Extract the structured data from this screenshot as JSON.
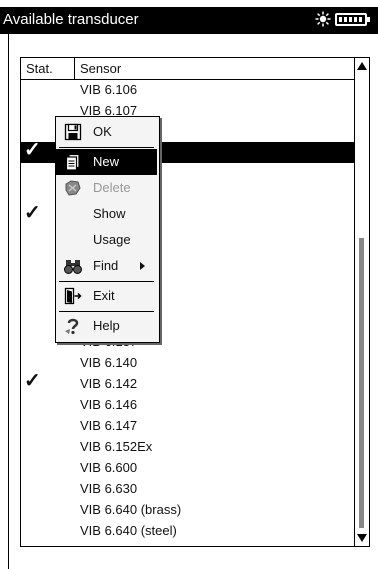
{
  "window": {
    "title": "Available transducer"
  },
  "table": {
    "headers": {
      "stat": "Stat.",
      "sensor": "Sensor"
    },
    "rows": [
      {
        "sensor": "VIB 6.106",
        "stat": ""
      },
      {
        "sensor": "VIB 6.107",
        "stat": ""
      },
      {
        "sensor": "",
        "stat": ""
      },
      {
        "sensor": "",
        "stat": "✓"
      },
      {
        "sensor": "",
        "stat": ""
      },
      {
        "sensor": "",
        "stat": ""
      },
      {
        "sensor": "",
        "stat": "✓"
      },
      {
        "sensor": "",
        "stat": ""
      },
      {
        "sensor": "",
        "stat": ""
      },
      {
        "sensor": "",
        "stat": ""
      },
      {
        "sensor": "",
        "stat": ""
      },
      {
        "sensor": "",
        "stat": ""
      },
      {
        "sensor": "VIB 6.137",
        "stat": ""
      },
      {
        "sensor": "VIB 6.140",
        "stat": ""
      },
      {
        "sensor": "VIB 6.142",
        "stat": "✓"
      },
      {
        "sensor": "VIB 6.146",
        "stat": ""
      },
      {
        "sensor": "VIB 6.147",
        "stat": ""
      },
      {
        "sensor": "VIB 6.152Ex",
        "stat": ""
      },
      {
        "sensor": "VIB 6.600",
        "stat": ""
      },
      {
        "sensor": "VIB 6.630",
        "stat": ""
      },
      {
        "sensor": "VIB 6.640 (brass)",
        "stat": ""
      },
      {
        "sensor": "VIB 6.640 (steel)",
        "stat": ""
      }
    ],
    "selected_row": 3
  },
  "context_menu": {
    "items": [
      {
        "label": "OK",
        "icon": "save-icon"
      },
      {
        "label": "New",
        "icon": "new-document-icon"
      },
      {
        "label": "Delete",
        "icon": "delete-icon"
      },
      {
        "label": "Show",
        "icon": ""
      },
      {
        "label": "Usage",
        "icon": ""
      },
      {
        "label": "Find",
        "icon": "binoculars-icon"
      },
      {
        "label": "Exit",
        "icon": "exit-door-icon"
      },
      {
        "label": "Help",
        "icon": "help-icon"
      }
    ],
    "highlighted": "New",
    "disabled": [
      "Delete"
    ]
  }
}
